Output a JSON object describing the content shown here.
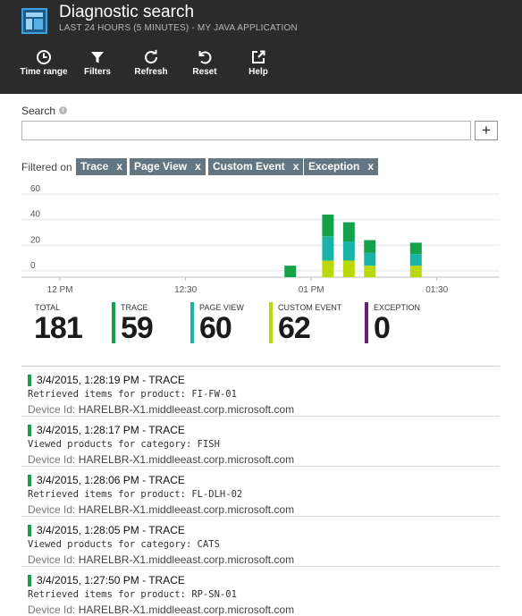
{
  "header": {
    "title": "Diagnostic search",
    "subtitle": "LAST 24 HOURS (5 MINUTES) - MY JAVA APPLICATION",
    "app_icon": "blade-layout-icon",
    "toolbar": [
      {
        "label": "Time range",
        "icon": "clock-icon"
      },
      {
        "label": "Filters",
        "icon": "funnel-icon"
      },
      {
        "label": "Refresh",
        "icon": "refresh-icon"
      },
      {
        "label": "Reset",
        "icon": "undo-icon"
      },
      {
        "label": "Help",
        "icon": "external-link-icon"
      }
    ]
  },
  "search": {
    "label": "Search",
    "value": "",
    "placeholder": "",
    "add_label": "+"
  },
  "filters": {
    "label": "Filtered on",
    "chips": [
      {
        "label": "Trace",
        "remove": "x"
      },
      {
        "label": "Page View",
        "remove": "x"
      },
      {
        "label": "Custom Event",
        "remove": "x"
      },
      {
        "label": "Exception",
        "remove": "x"
      }
    ]
  },
  "chart_data": {
    "type": "bar",
    "stacked": true,
    "yticks": [
      "60",
      "40",
      "20",
      "0"
    ],
    "ylim": [
      -5,
      65
    ],
    "xticks": [
      {
        "label": "12 PM",
        "t": 0
      },
      {
        "label": "12:30",
        "t": 30
      },
      {
        "label": "01 PM",
        "t": 60
      },
      {
        "label": "01:30",
        "t": 90
      }
    ],
    "xlim": [
      -9.2,
      105
    ],
    "x": [
      55,
      64,
      69,
      74,
      85
    ],
    "series": [
      {
        "name": "Custom Event",
        "color": "#bad80a",
        "values": [
          0,
          13,
          13,
          9,
          9
        ]
      },
      {
        "name": "Page View",
        "color": "#18b4a8",
        "values": [
          0,
          19,
          15,
          10,
          9
        ]
      },
      {
        "name": "Trace",
        "color": "#15a14b",
        "values": [
          9,
          17,
          15,
          10,
          9
        ]
      }
    ],
    "grid": true
  },
  "stats": [
    {
      "label": "TOTAL",
      "value": "181",
      "color": ""
    },
    {
      "label": "TRACE",
      "value": "59",
      "color": "#15a14b"
    },
    {
      "label": "PAGE VIEW",
      "value": "60",
      "color": "#18b4a8"
    },
    {
      "label": "CUSTOM EVENT",
      "value": "62",
      "color": "#bad80a"
    },
    {
      "label": "EXCEPTION",
      "value": "0",
      "color": "#68217a"
    }
  ],
  "results": [
    {
      "title": "3/4/2015, 1:28:19 PM - TRACE",
      "message": "Retrieved items for product: FI-FW-01",
      "device_label": "Device Id:",
      "device": "HARELBR-X1.middleeast.corp.microsoft.com"
    },
    {
      "title": "3/4/2015, 1:28:17 PM - TRACE",
      "message": "Viewed products for category: FISH",
      "device_label": "Device Id:",
      "device": "HARELBR-X1.middleeast.corp.microsoft.com"
    },
    {
      "title": "3/4/2015, 1:28:06 PM - TRACE",
      "message": "Retrieved items for product: FL-DLH-02",
      "device_label": "Device Id:",
      "device": "HARELBR-X1.middleeast.corp.microsoft.com"
    },
    {
      "title": "3/4/2015, 1:28:05 PM - TRACE",
      "message": "Viewed products for category: CATS",
      "device_label": "Device Id:",
      "device": "HARELBR-X1.middleeast.corp.microsoft.com"
    },
    {
      "title": "3/4/2015, 1:27:50 PM - TRACE",
      "message": "Retrieved items for product: RP-SN-01",
      "device_label": "Device Id:",
      "device": "HARELBR-X1.middleeast.corp.microsoft.com"
    }
  ]
}
